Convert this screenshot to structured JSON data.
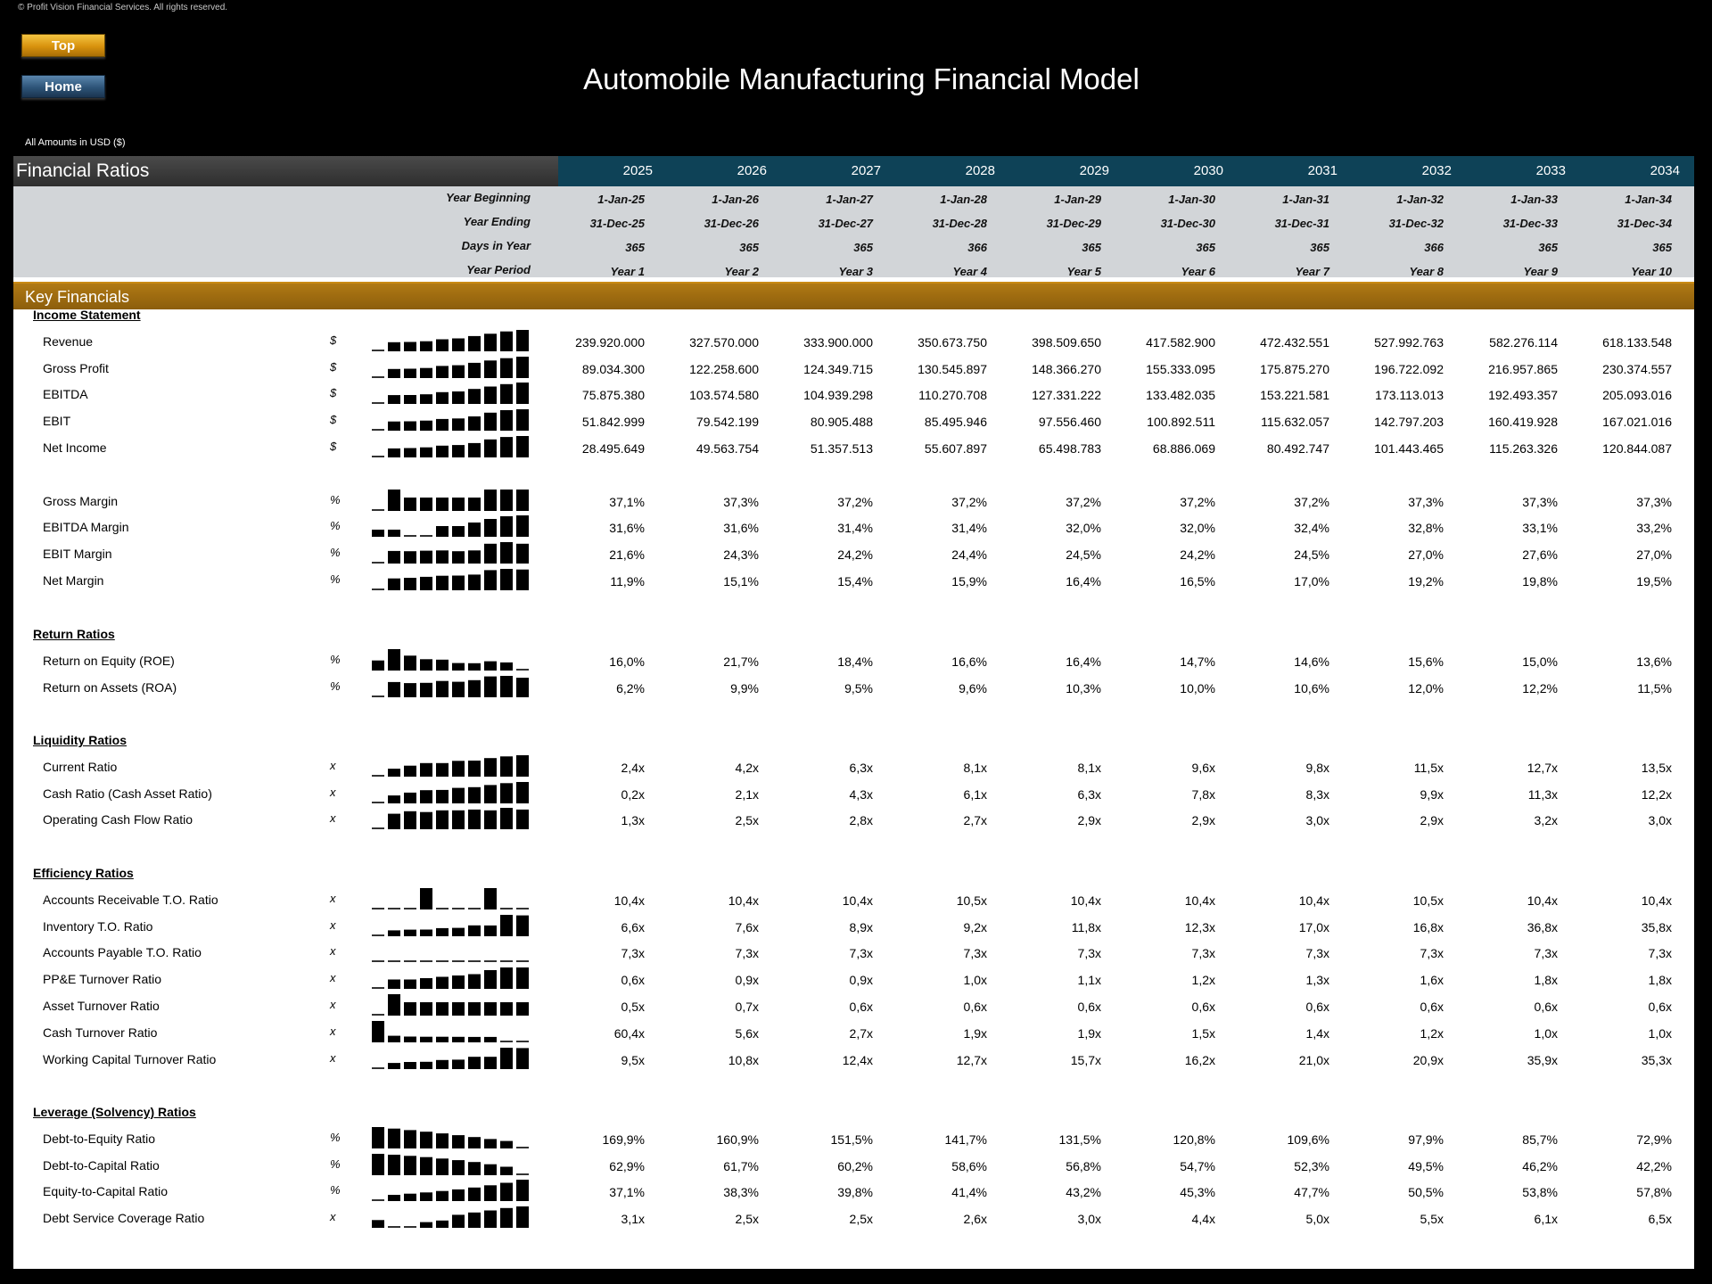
{
  "copyright": "© Profit Vision Financial Services. All rights reserved.",
  "nav": {
    "top_label": "Top",
    "home_label": "Home"
  },
  "title": "Automobile Manufacturing Financial Model",
  "currency_note": "All Amounts in  USD ($)",
  "sheet_title": "Financial Ratios",
  "years": [
    "2025",
    "2026",
    "2027",
    "2028",
    "2029",
    "2030",
    "2031",
    "2032",
    "2033",
    "2034"
  ],
  "period_info": [
    {
      "label": "Year Beginning",
      "values": [
        "1-Jan-25",
        "1-Jan-26",
        "1-Jan-27",
        "1-Jan-28",
        "1-Jan-29",
        "1-Jan-30",
        "1-Jan-31",
        "1-Jan-32",
        "1-Jan-33",
        "1-Jan-34"
      ]
    },
    {
      "label": "Year Ending",
      "values": [
        "31-Dec-25",
        "31-Dec-26",
        "31-Dec-27",
        "31-Dec-28",
        "31-Dec-29",
        "31-Dec-30",
        "31-Dec-31",
        "31-Dec-32",
        "31-Dec-33",
        "31-Dec-34"
      ]
    },
    {
      "label": "Days in Year",
      "values": [
        "365",
        "365",
        "365",
        "366",
        "365",
        "365",
        "365",
        "366",
        "365",
        "365"
      ]
    },
    {
      "label": "Year Period",
      "values": [
        "Year 1",
        "Year 2",
        "Year 3",
        "Year 4",
        "Year 5",
        "Year 6",
        "Year 7",
        "Year 8",
        "Year 9",
        "Year 10"
      ]
    }
  ],
  "band_title": "Key Financials",
  "sections": [
    {
      "title": "Income Statement",
      "groups": [
        [
          {
            "label": "Revenue",
            "unit": "$",
            "values": [
              "239.920.000",
              "327.570.000",
              "333.900.000",
              "350.673.750",
              "398.509.650",
              "417.582.900",
              "472.432.551",
              "527.992.763",
              "582.276.114",
              "618.133.548"
            ]
          },
          {
            "label": "Gross Profit",
            "unit": "$",
            "values": [
              "89.034.300",
              "122.258.600",
              "124.349.715",
              "130.545.897",
              "148.366.270",
              "155.333.095",
              "175.875.270",
              "196.722.092",
              "216.957.865",
              "230.374.557"
            ]
          },
          {
            "label": "EBITDA",
            "unit": "$",
            "values": [
              "75.875.380",
              "103.574.580",
              "104.939.298",
              "110.270.708",
              "127.331.222",
              "133.482.035",
              "153.221.581",
              "173.113.013",
              "192.493.357",
              "205.093.016"
            ]
          },
          {
            "label": "EBIT",
            "unit": "$",
            "values": [
              "51.842.999",
              "79.542.199",
              "80.905.488",
              "85.495.946",
              "97.556.460",
              "100.892.511",
              "115.632.057",
              "142.797.203",
              "160.419.928",
              "167.021.016"
            ]
          },
          {
            "label": "Net Income",
            "unit": "$",
            "values": [
              "28.495.649",
              "49.563.754",
              "51.357.513",
              "55.607.897",
              "65.498.783",
              "68.886.069",
              "80.492.747",
              "101.443.465",
              "115.263.326",
              "120.844.087"
            ]
          }
        ],
        [
          {
            "label": "Gross Margin",
            "unit": "%",
            "values": [
              "37,1%",
              "37,3%",
              "37,2%",
              "37,2%",
              "37,2%",
              "37,2%",
              "37,2%",
              "37,3%",
              "37,3%",
              "37,3%"
            ]
          },
          {
            "label": "EBITDA Margin",
            "unit": "%",
            "values": [
              "31,6%",
              "31,6%",
              "31,4%",
              "31,4%",
              "32,0%",
              "32,0%",
              "32,4%",
              "32,8%",
              "33,1%",
              "33,2%"
            ]
          },
          {
            "label": "EBIT Margin",
            "unit": "%",
            "values": [
              "21,6%",
              "24,3%",
              "24,2%",
              "24,4%",
              "24,5%",
              "24,2%",
              "24,5%",
              "27,0%",
              "27,6%",
              "27,0%"
            ]
          },
          {
            "label": "Net Margin",
            "unit": "%",
            "values": [
              "11,9%",
              "15,1%",
              "15,4%",
              "15,9%",
              "16,4%",
              "16,5%",
              "17,0%",
              "19,2%",
              "19,8%",
              "19,5%"
            ]
          }
        ]
      ]
    },
    {
      "title": "Return Ratios",
      "groups": [
        [
          {
            "label": "Return on Equity (ROE)",
            "unit": "%",
            "values": [
              "16,0%",
              "21,7%",
              "18,4%",
              "16,6%",
              "16,4%",
              "14,7%",
              "14,6%",
              "15,6%",
              "15,0%",
              "13,6%"
            ]
          },
          {
            "label": "Return on Assets (ROA)",
            "unit": "%",
            "values": [
              "6,2%",
              "9,9%",
              "9,5%",
              "9,6%",
              "10,3%",
              "10,0%",
              "10,6%",
              "12,0%",
              "12,2%",
              "11,5%"
            ]
          }
        ]
      ]
    },
    {
      "title": "Liquidity Ratios",
      "groups": [
        [
          {
            "label": "Current Ratio",
            "unit": "x",
            "values": [
              "2,4x",
              "4,2x",
              "6,3x",
              "8,1x",
              "8,1x",
              "9,6x",
              "9,8x",
              "11,5x",
              "12,7x",
              "13,5x"
            ]
          },
          {
            "label": "Cash Ratio (Cash Asset Ratio)",
            "unit": "x",
            "values": [
              "0,2x",
              "2,1x",
              "4,3x",
              "6,1x",
              "6,3x",
              "7,8x",
              "8,3x",
              "9,9x",
              "11,3x",
              "12,2x"
            ]
          },
          {
            "label": "Operating Cash Flow Ratio",
            "unit": "x",
            "values": [
              "1,3x",
              "2,5x",
              "2,8x",
              "2,7x",
              "2,9x",
              "2,9x",
              "3,0x",
              "2,9x",
              "3,2x",
              "3,0x"
            ]
          }
        ]
      ]
    },
    {
      "title": "Efficiency Ratios",
      "groups": [
        [
          {
            "label": "Accounts Receivable T.O. Ratio",
            "unit": "x",
            "values": [
              "10,4x",
              "10,4x",
              "10,4x",
              "10,5x",
              "10,4x",
              "10,4x",
              "10,4x",
              "10,5x",
              "10,4x",
              "10,4x"
            ]
          },
          {
            "label": "Inventory T.O. Ratio",
            "unit": "x",
            "values": [
              "6,6x",
              "7,6x",
              "8,9x",
              "9,2x",
              "11,8x",
              "12,3x",
              "17,0x",
              "16,8x",
              "36,8x",
              "35,8x"
            ]
          },
          {
            "label": "Accounts Payable T.O. Ratio",
            "unit": "x",
            "values": [
              "7,3x",
              "7,3x",
              "7,3x",
              "7,3x",
              "7,3x",
              "7,3x",
              "7,3x",
              "7,3x",
              "7,3x",
              "7,3x"
            ]
          },
          {
            "label": "PP&E Turnover Ratio",
            "unit": "x",
            "values": [
              "0,6x",
              "0,9x",
              "0,9x",
              "1,0x",
              "1,1x",
              "1,2x",
              "1,3x",
              "1,6x",
              "1,8x",
              "1,8x"
            ]
          },
          {
            "label": "Asset Turnover Ratio",
            "unit": "x",
            "values": [
              "0,5x",
              "0,7x",
              "0,6x",
              "0,6x",
              "0,6x",
              "0,6x",
              "0,6x",
              "0,6x",
              "0,6x",
              "0,6x"
            ]
          },
          {
            "label": "Cash Turnover Ratio",
            "unit": "x",
            "values": [
              "60,4x",
              "5,6x",
              "2,7x",
              "1,9x",
              "1,9x",
              "1,5x",
              "1,4x",
              "1,2x",
              "1,0x",
              "1,0x"
            ]
          },
          {
            "label": "Working Capital Turnover Ratio",
            "unit": "x",
            "values": [
              "9,5x",
              "10,8x",
              "12,4x",
              "12,7x",
              "15,7x",
              "16,2x",
              "21,0x",
              "20,9x",
              "35,9x",
              "35,3x"
            ]
          }
        ]
      ]
    },
    {
      "title": "Leverage (Solvency) Ratios",
      "groups": [
        [
          {
            "label": "Debt-to-Equity Ratio",
            "unit": "%",
            "values": [
              "169,9%",
              "160,9%",
              "151,5%",
              "141,7%",
              "131,5%",
              "120,8%",
              "109,6%",
              "97,9%",
              "85,7%",
              "72,9%"
            ]
          },
          {
            "label": "Debt-to-Capital Ratio",
            "unit": "%",
            "values": [
              "62,9%",
              "61,7%",
              "60,2%",
              "58,6%",
              "56,8%",
              "54,7%",
              "52,3%",
              "49,5%",
              "46,2%",
              "42,2%"
            ]
          },
          {
            "label": "Equity-to-Capital Ratio",
            "unit": "%",
            "values": [
              "37,1%",
              "38,3%",
              "39,8%",
              "41,4%",
              "43,2%",
              "45,3%",
              "47,7%",
              "50,5%",
              "53,8%",
              "57,8%"
            ]
          },
          {
            "label": "Debt Service Coverage Ratio",
            "unit": "x",
            "values": [
              "3,1x",
              "2,5x",
              "2,5x",
              "2,6x",
              "3,0x",
              "4,4x",
              "5,0x",
              "5,5x",
              "6,1x",
              "6,5x"
            ]
          }
        ]
      ]
    }
  ]
}
